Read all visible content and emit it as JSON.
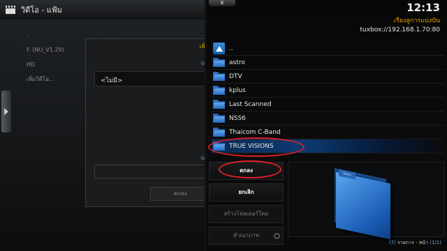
{
  "background_window": {
    "title": "วิดีโอ - แฟ้ม",
    "list": [
      ".",
      "F. (NU_V1.29)",
      "HD",
      "เพิ่มวิดีโอ..."
    ],
    "dialog": {
      "heading": "เพิ่ม",
      "hint_top": "ป้อน",
      "field_value": "<ไม่มี>",
      "hint_bottom": "ป้อน",
      "ok_label": "ตกลง"
    }
  },
  "panel": {
    "close_label": "x",
    "clock": "12:13",
    "sort_label": "เรียงลูการแบ่งปัน",
    "path": "tuxbox://192.168.1.70:80",
    "items": [
      {
        "label": "..",
        "icon": "up-arrow-icon"
      },
      {
        "label": "astro",
        "icon": "folder-icon"
      },
      {
        "label": "DTV",
        "icon": "folder-icon"
      },
      {
        "label": "kplus",
        "icon": "folder-icon"
      },
      {
        "label": "Last Scanned",
        "icon": "folder-icon"
      },
      {
        "label": "NSS6",
        "icon": "folder-icon"
      },
      {
        "label": "Thaicom C-Band",
        "icon": "folder-icon"
      },
      {
        "label": "TRUE VISIONS",
        "icon": "folder-icon",
        "selected": true
      }
    ],
    "actions": {
      "ok": "ตกลง",
      "cancel": "ยกเลิก",
      "new_folder": "สร้างโฟลเดอร์ใหม่",
      "mirror": "สำเนาภาพ"
    },
    "preview_folder_tab": "Share",
    "footer": {
      "count": "(7)",
      "text_mid": " รายการ - หน้า ",
      "page": "(1/1)"
    }
  },
  "colors": {
    "accent_orange": "#e8a400",
    "accent_blue": "#6aa3d8",
    "annotation_red": "#e0202a"
  }
}
